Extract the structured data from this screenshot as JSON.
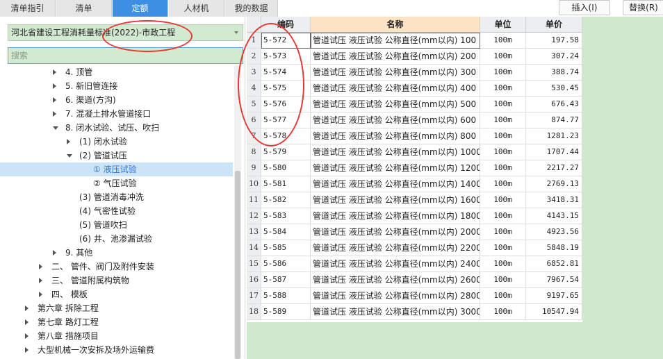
{
  "tabs": [
    "清单指引",
    "清单",
    "定额",
    "人材机",
    "我的数据"
  ],
  "active_tab": 2,
  "top_buttons": {
    "insert": "插入(I)",
    "replace": "替换(R)"
  },
  "library": {
    "selected": "河北省建设工程消耗量标准(2022)-市政工程"
  },
  "search": {
    "placeholder": "搜索"
  },
  "tree": [
    {
      "label": "4. 顶管",
      "state": "collapsed",
      "level": 4
    },
    {
      "label": "5. 新旧管连接",
      "state": "collapsed",
      "level": 4
    },
    {
      "label": "6. 渠道(方沟)",
      "state": "collapsed",
      "level": 4
    },
    {
      "label": "7. 混凝土排水管道接口",
      "state": "collapsed",
      "level": 4
    },
    {
      "label": "8. 闭水试验、试压、吹扫",
      "state": "expanded",
      "level": 4
    },
    {
      "label": "(1) 闭水试验",
      "state": "collapsed",
      "level": 5
    },
    {
      "label": "(2) 管道试压",
      "state": "expanded",
      "level": 5
    },
    {
      "label": "① 液压试验",
      "state": "leaf",
      "level": 6,
      "selected": true
    },
    {
      "label": "② 气压试验",
      "state": "leaf",
      "level": 6
    },
    {
      "label": "(3) 管道消毒冲洗",
      "state": "leaf",
      "level": 5
    },
    {
      "label": "(4) 气密性试验",
      "state": "leaf",
      "level": 5
    },
    {
      "label": "(5) 管道吹扫",
      "state": "leaf",
      "level": 5
    },
    {
      "label": "(6) 井、池渗漏试验",
      "state": "leaf",
      "level": 5
    },
    {
      "label": "9. 其他",
      "state": "collapsed",
      "level": 4
    },
    {
      "label": "二、 管件、阀门及附件安装",
      "state": "collapsed",
      "level": 3
    },
    {
      "label": "三、 管道附属构筑物",
      "state": "collapsed",
      "level": 3
    },
    {
      "label": "四、 模板",
      "state": "collapsed",
      "level": 3
    },
    {
      "label": "第六章 拆除工程",
      "state": "collapsed",
      "level": 2
    },
    {
      "label": "第七章 路灯工程",
      "state": "collapsed",
      "level": 2
    },
    {
      "label": "第八章 措施项目",
      "state": "collapsed",
      "level": 2
    },
    {
      "label": "大型机械一次安拆及场外运输费",
      "state": "collapsed",
      "level": 2
    }
  ],
  "table": {
    "headers": {
      "code": "编码",
      "name": "名称",
      "unit": "单位",
      "price": "单价"
    },
    "rows": [
      {
        "idx": "1",
        "code": "5-572",
        "name": "管道试压 液压试验 公称直径(mm以内) 100",
        "unit": "100m",
        "price": "197.58"
      },
      {
        "idx": "2",
        "code": "5-573",
        "name": "管道试压 液压试验 公称直径(mm以内) 200",
        "unit": "100m",
        "price": "307.24"
      },
      {
        "idx": "3",
        "code": "5-574",
        "name": "管道试压 液压试验 公称直径(mm以内) 300",
        "unit": "100m",
        "price": "388.74"
      },
      {
        "idx": "4",
        "code": "5-575",
        "name": "管道试压 液压试验 公称直径(mm以内) 400",
        "unit": "100m",
        "price": "530.45"
      },
      {
        "idx": "5",
        "code": "5-576",
        "name": "管道试压 液压试验 公称直径(mm以内) 500",
        "unit": "100m",
        "price": "676.43"
      },
      {
        "idx": "6",
        "code": "5-577",
        "name": "管道试压 液压试验 公称直径(mm以内) 600",
        "unit": "100m",
        "price": "874.77"
      },
      {
        "idx": "7",
        "code": "5-578",
        "name": "管道试压 液压试验 公称直径(mm以内) 800",
        "unit": "100m",
        "price": "1281.23"
      },
      {
        "idx": "8",
        "code": "5-579",
        "name": "管道试压 液压试验 公称直径(mm以内) 1000",
        "unit": "100m",
        "price": "1707.44"
      },
      {
        "idx": "9",
        "code": "5-580",
        "name": "管道试压 液压试验 公称直径(mm以内) 1200",
        "unit": "100m",
        "price": "2217.27"
      },
      {
        "idx": "10",
        "code": "5-581",
        "name": "管道试压 液压试验 公称直径(mm以内) 1400",
        "unit": "100m",
        "price": "2769.13"
      },
      {
        "idx": "11",
        "code": "5-582",
        "name": "管道试压 液压试验 公称直径(mm以内) 1600",
        "unit": "100m",
        "price": "3418.31"
      },
      {
        "idx": "12",
        "code": "5-583",
        "name": "管道试压 液压试验 公称直径(mm以内) 1800",
        "unit": "100m",
        "price": "4143.15"
      },
      {
        "idx": "13",
        "code": "5-584",
        "name": "管道试压 液压试验 公称直径(mm以内) 2000",
        "unit": "100m",
        "price": "4923.56"
      },
      {
        "idx": "14",
        "code": "5-585",
        "name": "管道试压 液压试验 公称直径(mm以内) 2200",
        "unit": "100m",
        "price": "5848.19"
      },
      {
        "idx": "15",
        "code": "5-586",
        "name": "管道试压 液压试验 公称直径(mm以内) 2400",
        "unit": "100m",
        "price": "6852.81"
      },
      {
        "idx": "16",
        "code": "5-587",
        "name": "管道试压 液压试验 公称直径(mm以内) 2600",
        "unit": "100m",
        "price": "7967.54"
      },
      {
        "idx": "17",
        "code": "5-588",
        "name": "管道试压 液压试验 公称直径(mm以内) 2800",
        "unit": "100m",
        "price": "9197.65"
      },
      {
        "idx": "18",
        "code": "5-589",
        "name": "管道试压 液压试验 公称直径(mm以内) 3000",
        "unit": "100m",
        "price": "10547.94"
      }
    ]
  },
  "colors": {
    "accent": "#3c8fe2",
    "panel_green": "#d2ebd0",
    "annotation_red": "#e53935",
    "name_header": "#fbe3c4"
  }
}
